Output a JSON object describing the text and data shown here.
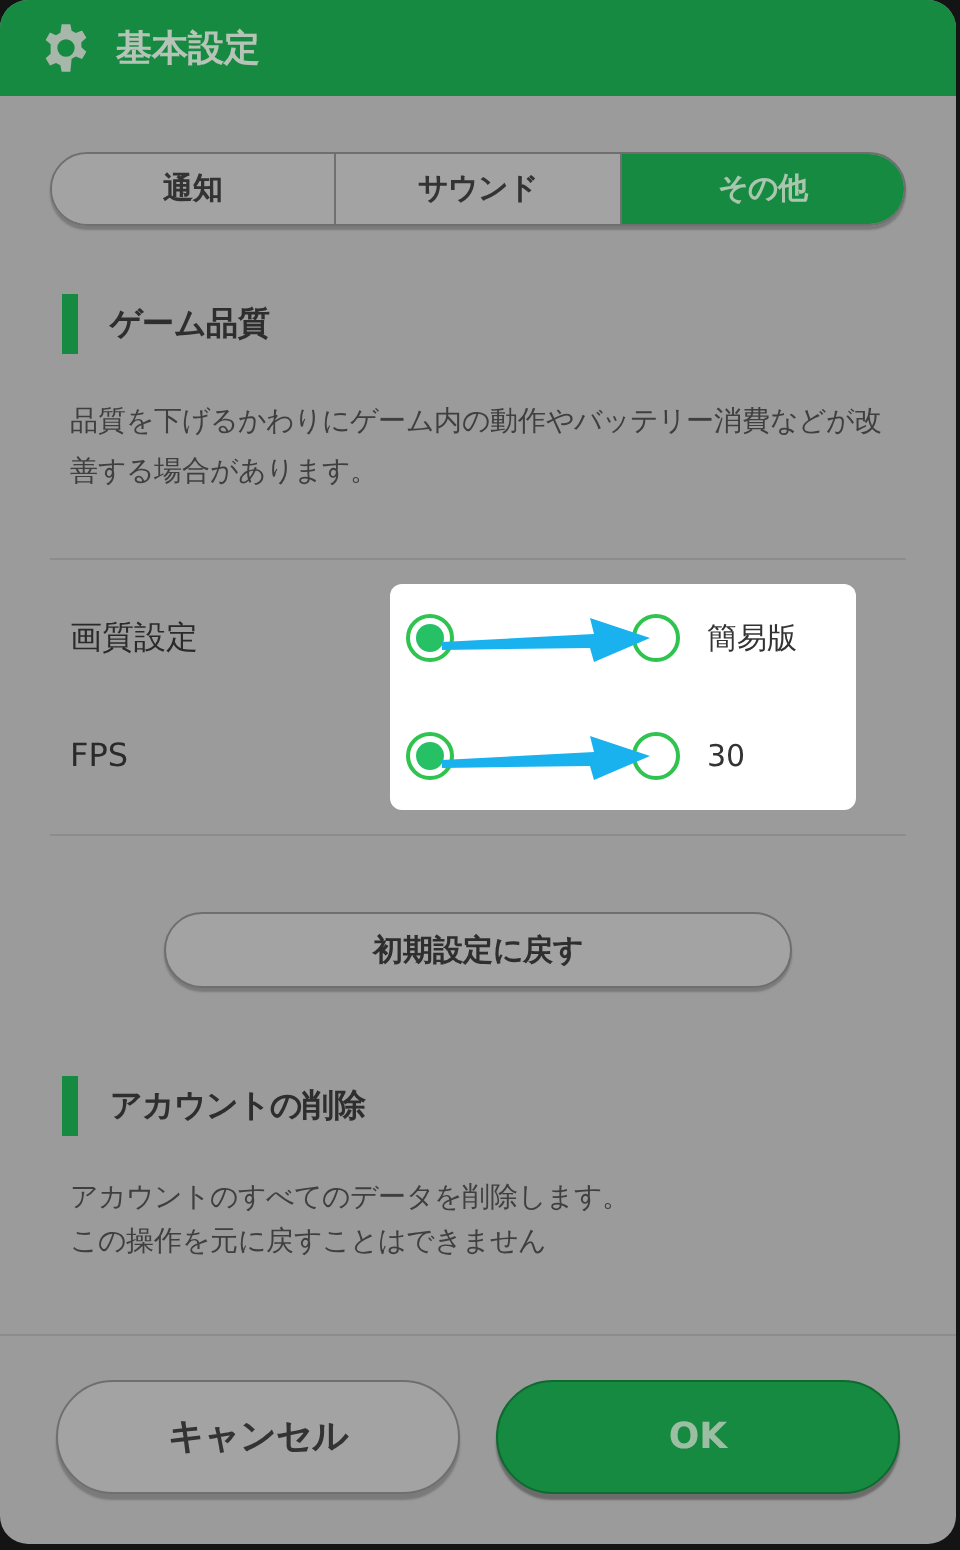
{
  "title": "基本設定",
  "tabs": [
    {
      "label": "通知",
      "selected": false
    },
    {
      "label": "サウンド",
      "selected": false
    },
    {
      "label": "その他",
      "selected": true
    }
  ],
  "game_quality": {
    "heading": "ゲーム品質",
    "description": "品質を下げるかわりにゲーム内の動作やバッテリー消費などが改善する場合があります。"
  },
  "settings": [
    {
      "label": "画質設定",
      "options": [
        {
          "selected": true
        },
        {
          "label": "簡易版",
          "selected": false
        }
      ]
    },
    {
      "label": "FPS",
      "options": [
        {
          "selected": true
        },
        {
          "label": "30",
          "selected": false
        }
      ]
    }
  ],
  "reset_button": "初期設定に戻す",
  "account_deletion": {
    "heading": "アカウントの削除",
    "description_lines": [
      "アカウントのすべてのデータを削除します。",
      "この操作を元に戻すことはできません"
    ]
  },
  "buttons": {
    "cancel": "キャンセル",
    "ok": "OK"
  }
}
